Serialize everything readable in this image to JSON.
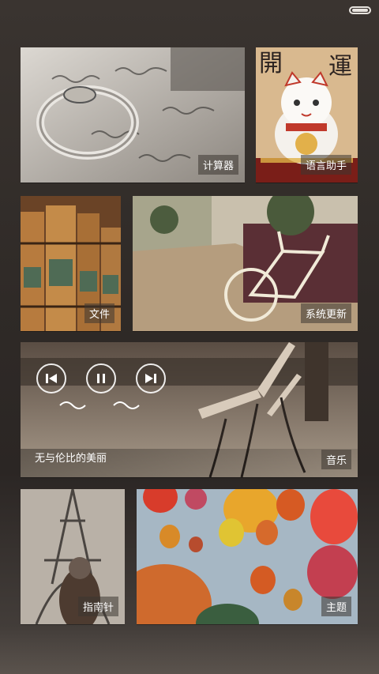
{
  "status_bar": {
    "battery_icon": "battery-icon"
  },
  "tiles": {
    "calculator": {
      "label": "计算器",
      "image": "ring-on-love-letters"
    },
    "voice_assistant": {
      "label": "语言助手",
      "image": "lucky-cat"
    },
    "files": {
      "label": "文件",
      "image": "old-books"
    },
    "system_update": {
      "label": "系统更新",
      "image": "bicycle-street"
    },
    "music": {
      "label": "音乐",
      "song_title": "无与伦比的美丽",
      "image": "park-bench",
      "controls": [
        "previous-icon",
        "pause-icon",
        "next-icon"
      ]
    },
    "compass": {
      "label": "指南针",
      "image": "eiffel-tower"
    },
    "theme": {
      "label": "主题",
      "image": "hot-air-balloons"
    }
  }
}
